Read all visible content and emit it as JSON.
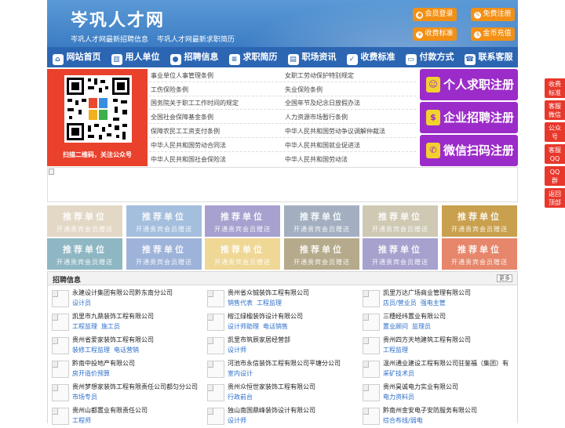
{
  "header": {
    "title": "岑巩人才网",
    "subtitles": [
      "岑巩人才网最新招聘信息",
      "岑巩人才网最新求职简历"
    ],
    "buttons": [
      {
        "label": "会员登录",
        "icon": "user-icon"
      },
      {
        "label": "免费注册",
        "icon": "pencil-icon"
      },
      {
        "label": "收费标准",
        "icon": "yen-icon"
      },
      {
        "label": "金币充值",
        "icon": "coin-icon"
      }
    ]
  },
  "nav": [
    {
      "label": "网站首页",
      "icon": "home-icon"
    },
    {
      "label": "用人单位",
      "icon": "building-icon"
    },
    {
      "label": "招聘信息",
      "icon": "speech-icon"
    },
    {
      "label": "求职简历",
      "icon": "resume-icon"
    },
    {
      "label": "职场资讯",
      "icon": "news-icon"
    },
    {
      "label": "收费标准",
      "icon": "pricetag-icon"
    },
    {
      "label": "付款方式",
      "icon": "card-icon"
    },
    {
      "label": "联系客服",
      "icon": "phone-icon"
    }
  ],
  "qr": {
    "caption": "扫描二维码，关注公众号"
  },
  "laws": [
    [
      "事业单位人事管理条例",
      "女职工劳动保护特别规定"
    ],
    [
      "工伤保险条例",
      "失业保险条例"
    ],
    [
      "国务院关于职工工作时间的规定",
      "全国年节及纪念日放假办法"
    ],
    [
      "全国社会保障基金条例",
      "人力资源市场暂行条例"
    ],
    [
      "保障农民工工资支付条例",
      "中华人民共和国劳动争议调解仲裁法"
    ],
    [
      "中华人民共和国劳动合同法",
      "中华人民共和国就业促进法"
    ],
    [
      "中华人民共和国社会保险法",
      "中华人民共和国劳动法"
    ]
  ],
  "register": [
    {
      "label": "个人求职注册",
      "icon": "person-icon"
    },
    {
      "label": "企业招聘注册",
      "icon": "enterprise-icon"
    },
    {
      "label": "微信扫码注册",
      "icon": "wechat-icon"
    }
  ],
  "recommend": {
    "title": "推荐单位",
    "subtitle": "开通贵宾会员赠送",
    "colors": [
      "#e3d8c6",
      "#a4bede",
      "#a6a1cf",
      "#a3afc1",
      "#cfc9b4",
      "#c9a04e",
      "#8fb7c3",
      "#9eb3d9",
      "#efd796",
      "#b5aa8b",
      "#a7a1ce",
      "#e6866b"
    ]
  },
  "jobs": {
    "title": "招聘信息",
    "more": "更多",
    "items": [
      {
        "company": "永建设计集团有限公司黔东南分公司",
        "positions": [
          "设计员"
        ]
      },
      {
        "company": "贵州省众铖装饰工程有限公司",
        "positions": [
          "销售代表",
          "工程监理"
        ]
      },
      {
        "company": "凯里万达广场商业管理有限公司",
        "positions": [
          "店员/营业员",
          "强电主管"
        ]
      },
      {
        "company": "凯里市九鼎装饰工程有限公司",
        "positions": [
          "工程监理",
          "施工员"
        ]
      },
      {
        "company": "榕江绿楹装饰设计有限公司",
        "positions": [
          "设计师助理",
          "电话销售"
        ]
      },
      {
        "company": "三穗经纬置业有限公司",
        "positions": [
          "置业顾问",
          "监理员"
        ]
      },
      {
        "company": "贵州省爱家装饰工程有限公司",
        "positions": [
          "装修工程监理",
          "电话营销"
        ]
      },
      {
        "company": "凯里市筑辰家居经营部",
        "positions": [
          "设计师"
        ]
      },
      {
        "company": "贵州四方天地建筑工程有限公司",
        "positions": [
          "工程监理"
        ]
      },
      {
        "company": "黔南中投地产有限公司",
        "positions": [
          "房开造价预算"
        ]
      },
      {
        "company": "河池市永信装饰工程有限公司平塘分公司",
        "positions": [
          "室内设计"
        ]
      },
      {
        "company": "温州通业建设工程有限公司驻鉴福（集团）有",
        "positions": [
          "采矿技术员"
        ]
      },
      {
        "company": "贵州梦想家装饰工程有限责任公司都匀分公司",
        "positions": [
          "市场专员"
        ]
      },
      {
        "company": "贵州众恒世家装饰工程有限公司",
        "positions": [
          "行政前台"
        ]
      },
      {
        "company": "贵州昊诚电力实业有限公司",
        "positions": [
          "电力资料员"
        ]
      },
      {
        "company": "贵州山都置业有限责任公司",
        "positions": [
          "工程师"
        ]
      },
      {
        "company": "独山南国鼎峰装饰设计有限公司",
        "positions": [
          "设计师"
        ]
      },
      {
        "company": "黔南州金安电子安防服务有限公司",
        "positions": [
          "综合布线/弱电"
        ]
      }
    ]
  },
  "sidebar": [
    "收费标准",
    "客服微信",
    "公众号",
    "客服QQ号",
    "QQ群",
    "返回顶部"
  ]
}
